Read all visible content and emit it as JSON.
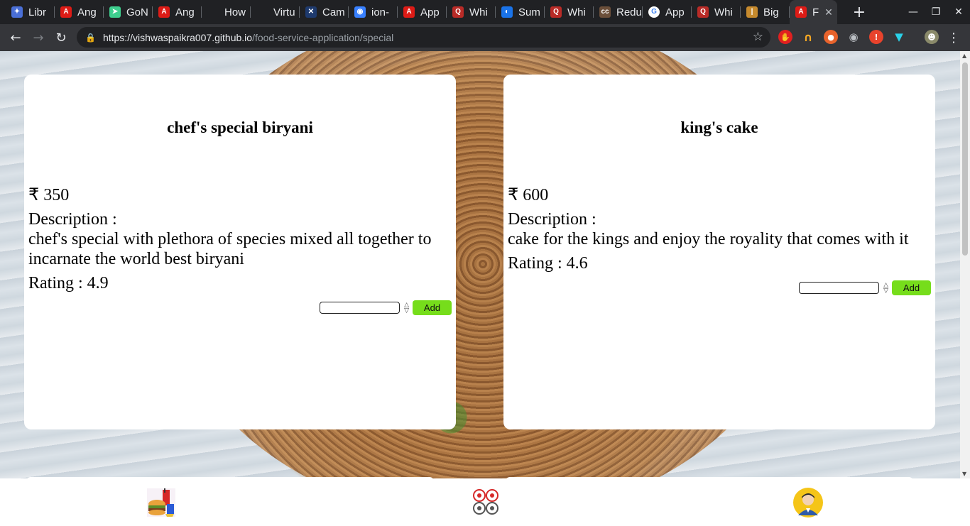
{
  "browser": {
    "tabs": [
      {
        "label": "Libr",
        "icon": "globe-icon",
        "color": "#4a6fd6"
      },
      {
        "label": "Ang",
        "icon": "angular-icon",
        "color": "#dd1b16"
      },
      {
        "label": "GoN",
        "icon": "paper-plane-icon",
        "color": "#3ecf8e"
      },
      {
        "label": "Ang",
        "icon": "angular-icon",
        "color": "#dd1b16"
      },
      {
        "label": "How",
        "icon": "blank-icon",
        "color": "#202124"
      },
      {
        "label": "Virtu",
        "icon": "blank-icon",
        "color": "#202124"
      },
      {
        "label": "Cam",
        "icon": "x-icon",
        "color": "#1e3a6e"
      },
      {
        "label": "ion-",
        "icon": "ionic-icon",
        "color": "#3880ff"
      },
      {
        "label": "App",
        "icon": "angular-icon",
        "color": "#dd1b16"
      },
      {
        "label": "Whi",
        "icon": "quora-icon",
        "color": "#b92b27"
      },
      {
        "label": "Sum",
        "icon": "medium-icon",
        "color": "#1a73e8"
      },
      {
        "label": "Whi",
        "icon": "quora-icon",
        "color": "#b92b27"
      },
      {
        "label": "Redu",
        "icon": "cc-icon",
        "color": "#6b4f3a"
      },
      {
        "label": "App",
        "icon": "google-icon",
        "color": "#ffffff"
      },
      {
        "label": "Whi",
        "icon": "quora-icon",
        "color": "#b92b27"
      },
      {
        "label": "Big",
        "icon": "bars-icon",
        "color": "#c68a2e"
      }
    ],
    "active_tab": {
      "label": "F",
      "icon": "angular-icon",
      "color": "#dd1b16"
    },
    "url_host": "https://vishwaspaikra007.github.io",
    "url_path": "/food-service-application/special"
  },
  "items": [
    {
      "name": "chef's special biryani",
      "price": "₹ 350",
      "description_label": "Description :",
      "description": "chef's special with plethora of species mixed all together to incarnate the world best biryani",
      "rating": "Rating : 4.9",
      "add_label": "Add"
    },
    {
      "name": "king's cake",
      "price": "₹ 600",
      "description_label": "Description :",
      "description": "cake for the kings and enjoy the royality that comes with it",
      "rating": "Rating : 4.6",
      "add_label": "Add"
    }
  ],
  "bottom_nav": [
    {
      "icon": "fast-food-icon"
    },
    {
      "icon": "special-menu-icon"
    },
    {
      "icon": "user-profile-icon"
    }
  ],
  "colors": {
    "add_button": "#76dd1b",
    "card_bg": "#ffffff"
  }
}
